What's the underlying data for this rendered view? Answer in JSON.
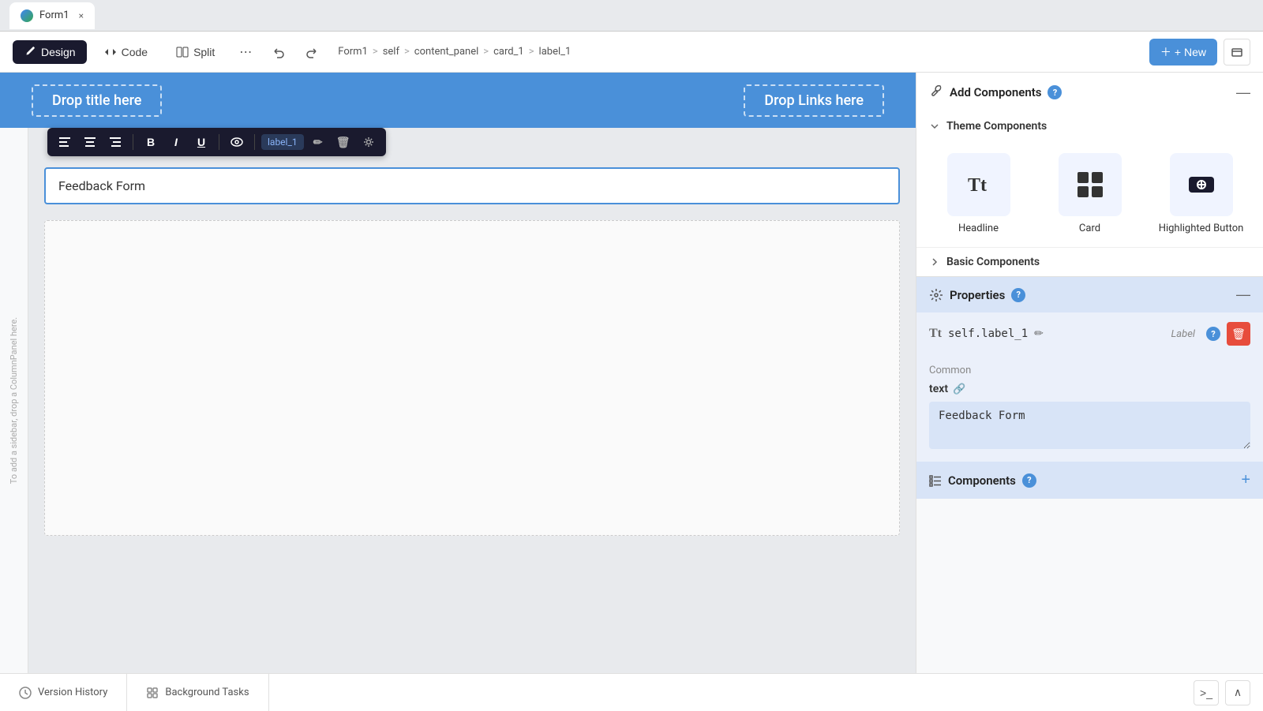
{
  "tab": {
    "title": "Form1",
    "close_label": "×"
  },
  "toolbar": {
    "design_label": "Design",
    "code_label": "Code",
    "split_label": "Split",
    "more_label": "⋯",
    "undo_label": "↩",
    "redo_label": "↪",
    "breadcrumb": {
      "form": "Form1",
      "sep1": ">",
      "self": "self",
      "sep2": ">",
      "content_panel": "content_panel",
      "sep3": ">",
      "card_1": "card_1",
      "sep4": ">",
      "label_1": "label_1"
    },
    "new_label": "+ New",
    "expand_label": "⤢"
  },
  "canvas": {
    "header": {
      "drop_title": "Drop title here",
      "drop_links": "Drop Links here"
    },
    "sidebar_hint": "To add a sidebar, drop a ColumnPanel here.",
    "label_value": "Feedback Form",
    "label_toolbar": {
      "align_left": "≡",
      "align_center": "≡",
      "align_right": "≡",
      "bold": "B",
      "italic": "I",
      "underline": "U",
      "eye": "👁",
      "name": "label_1",
      "edit": "✏",
      "delete": "🗑",
      "settings": "⚙"
    }
  },
  "right_panel": {
    "add_components": {
      "title": "Add Components",
      "help": "?",
      "collapse": "—"
    },
    "theme_components": {
      "title": "Theme Components",
      "items": [
        {
          "label": "Headline",
          "icon": "Tt"
        },
        {
          "label": "Card",
          "icon": "⊞"
        },
        {
          "label": "Highlighted Button",
          "icon": "🖱"
        }
      ]
    },
    "basic_components": {
      "title": "Basic Components"
    },
    "properties": {
      "title": "Properties",
      "help": "?",
      "collapse": "—",
      "prop_icon": "Tt",
      "prop_name": "self.label_1",
      "prop_edit": "✏",
      "prop_type": "Label",
      "prop_help": "?",
      "prop_delete": "🗑"
    },
    "common": {
      "title": "Common",
      "text_prop": "text",
      "link_icon": "🔗",
      "text_value": "Feedback Form"
    },
    "components_section": {
      "title": "Components",
      "help": "?",
      "add": "+"
    }
  },
  "bottom_bar": {
    "version_history": "Version History",
    "background_tasks": "Background Tasks",
    "terminal_icon": ">_",
    "chevron_up": "∧"
  }
}
